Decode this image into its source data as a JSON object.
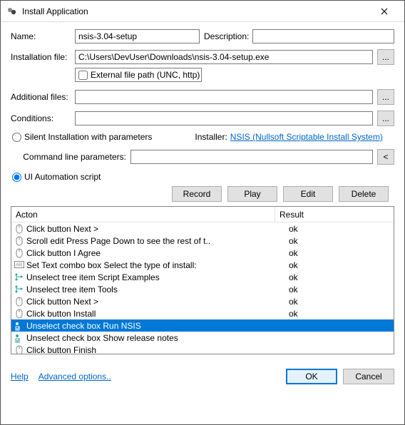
{
  "window": {
    "title": "Install Application"
  },
  "labels": {
    "name": "Name:",
    "description": "Description:",
    "installation_file": "Installation file:",
    "external_file_path": "External file path (UNC, http)",
    "additional_files": "Additional files:",
    "conditions": "Conditions:",
    "silent_install": "Silent Installation with parameters",
    "installer": "Installer:",
    "command_line_params": "Command line parameters:",
    "ui_automation": "UI Automation script",
    "help": "Help",
    "advanced": "Advanced options..",
    "ok": "OK",
    "cancel": "Cancel",
    "record": "Record",
    "play": "Play",
    "edit": "Edit",
    "delete": "Delete"
  },
  "values": {
    "name": "nsis-3.04-setup",
    "description": "",
    "installation_file": "C:\\Users\\DevUser\\Downloads\\nsis-3.04-setup.exe",
    "external_checked": false,
    "additional_files": "",
    "conditions": "",
    "installer_link": "NSIS (Nullsoft Scriptable Install System)",
    "command_line_params": "",
    "mode": "ui_automation"
  },
  "grid": {
    "col_action": "Acton",
    "col_result": "Result",
    "rows": [
      {
        "icon": "mouse",
        "action": "Click button Next >",
        "result": "ok",
        "selected": false
      },
      {
        "icon": "mouse",
        "action": "Scroll edit Press Page Down to see the rest of t..",
        "result": "ok",
        "selected": false
      },
      {
        "icon": "mouse",
        "action": "Click button I Agree",
        "result": "ok",
        "selected": false
      },
      {
        "icon": "text",
        "action": "Set Text combo box Select the type of install:",
        "result": "ok",
        "selected": false
      },
      {
        "icon": "tree",
        "action": "Unselect tree item Script Examples",
        "result": "ok",
        "selected": false
      },
      {
        "icon": "tree",
        "action": "Unselect tree item Tools",
        "result": "ok",
        "selected": false
      },
      {
        "icon": "mouse",
        "action": "Click button Next >",
        "result": "ok",
        "selected": false
      },
      {
        "icon": "mouse",
        "action": "Click button Install",
        "result": "ok",
        "selected": false
      },
      {
        "icon": "check",
        "action": "Unselect check box Run NSIS",
        "result": "",
        "selected": true
      },
      {
        "icon": "check",
        "action": "Unselect check box Show release notes",
        "result": "",
        "selected": false
      },
      {
        "icon": "mouse",
        "action": "Click button Finish",
        "result": "",
        "selected": false
      }
    ]
  },
  "icons": {
    "browse": "...",
    "less": "<"
  }
}
